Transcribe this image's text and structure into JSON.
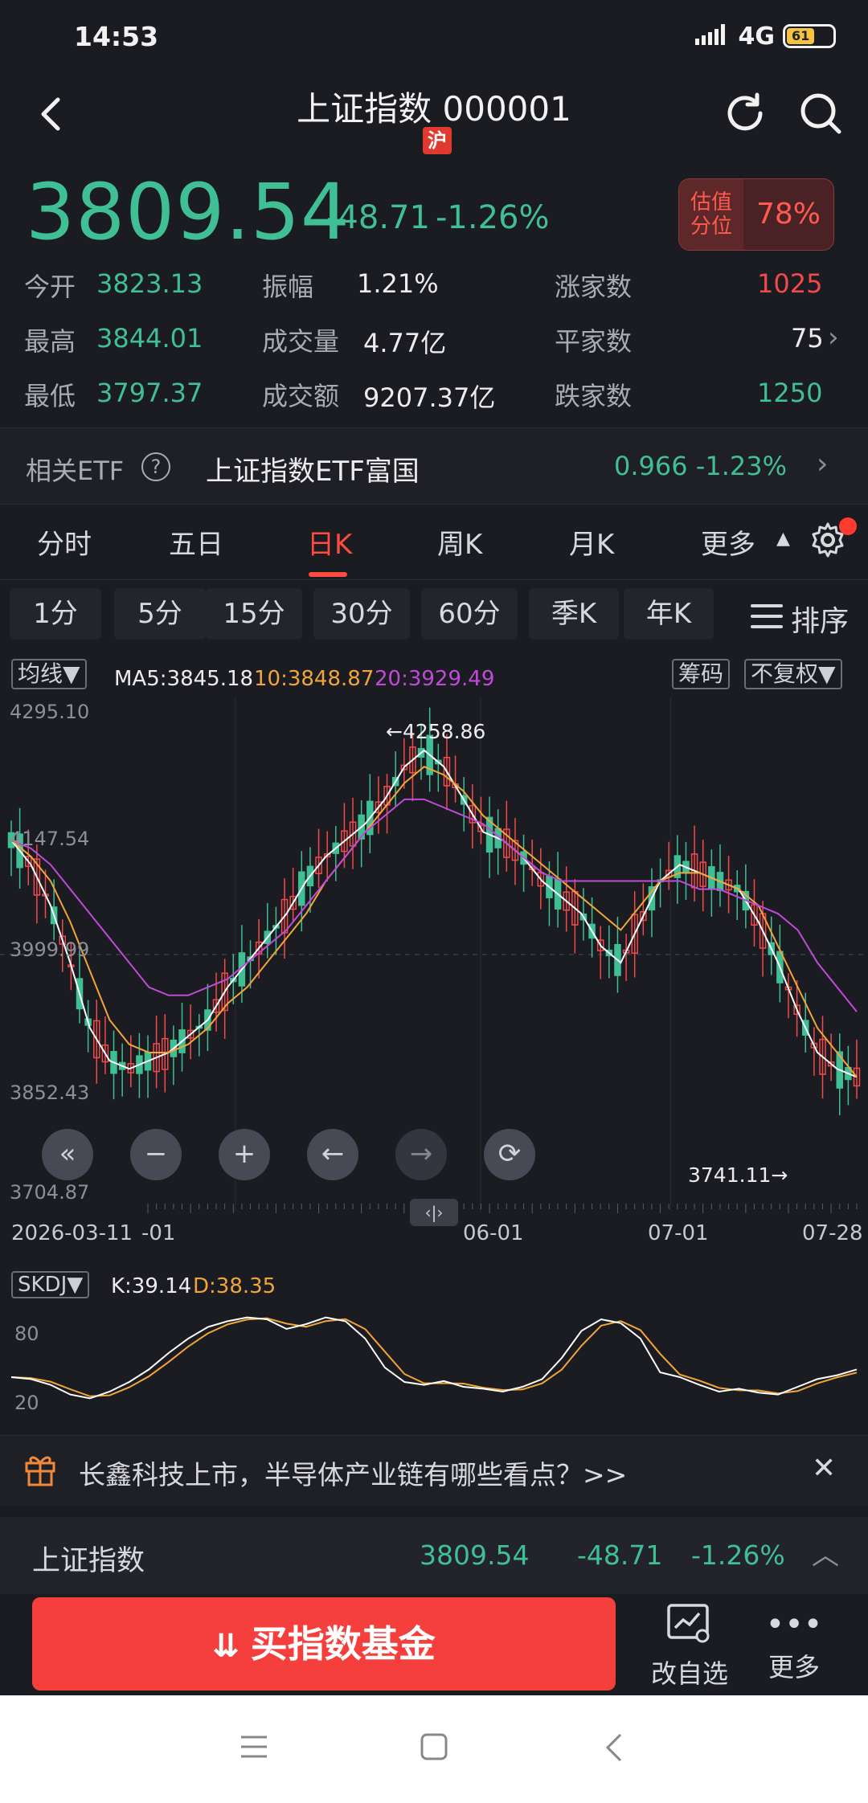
{
  "status_bar": {
    "time": "14:53",
    "network": "4G",
    "battery": "61"
  },
  "header": {
    "title": "上证指数 000001",
    "market_badge": "沪"
  },
  "quote": {
    "price": "3809.54",
    "change": "-48.71",
    "change_pct": "-1.26%",
    "valuation_label_line1": "估值",
    "valuation_label_line2": "分位",
    "valuation_value": "78%"
  },
  "stats": {
    "open_label": "今开",
    "open": "3823.13",
    "high_label": "最高",
    "high": "3844.01",
    "low_label": "最低",
    "low": "3797.37",
    "amplitude_label": "振幅",
    "amplitude": "1.21%",
    "volume_label": "成交量",
    "volume": "4.77亿",
    "turnover_label": "成交额",
    "turnover": "9207.37亿",
    "up_label": "涨家数",
    "up": "1025",
    "flat_label": "平家数",
    "flat": "75",
    "down_label": "跌家数",
    "down": "1250"
  },
  "etf": {
    "label": "相关ETF",
    "name": "上证指数ETF富国",
    "quote": "0.966 -1.23%"
  },
  "period_tabs": [
    "分时",
    "五日",
    "日K",
    "周K",
    "月K",
    "更多"
  ],
  "minute_tabs": [
    "1分",
    "5分",
    "15分",
    "30分",
    "60分",
    "季K",
    "年K"
  ],
  "sort_label": "排序",
  "chart": {
    "indicator_select": "均线▼",
    "ma5": "MA5:3845.18",
    "ma10": "10:3848.87",
    "ma20": "20:3929.49",
    "chips_btn": "筹码",
    "adjust_btn": "不复权▼",
    "y_labels": [
      "4295.10",
      "4147.54",
      "3999.99",
      "3852.43",
      "3704.87"
    ],
    "max_annot": "←4258.86",
    "min_annot": "3741.11→",
    "x_labels": [
      "2026-03-11",
      "-01",
      "06-01",
      "07-01",
      "07-28"
    ],
    "colors": {
      "up": "#f24a4a",
      "down": "#3fbf93",
      "ma5": "#ffffff",
      "ma10": "#f0a53a",
      "ma20": "#c04ad8"
    }
  },
  "chart_data": {
    "type": "line",
    "title": "",
    "y_ticks": [
      4295.1,
      4147.54,
      3999.99,
      3852.43,
      3704.87
    ],
    "x_ticks": [
      "2026-03-11",
      "-01",
      "06-01",
      "07-01",
      "07-28"
    ],
    "series": [
      {
        "name": "MA5",
        "values": [
          4140,
          4110,
          4060,
          3990,
          3910,
          3870,
          3860,
          3870,
          3880,
          3900,
          3920,
          3960,
          3990,
          4020,
          4050,
          4090,
          4120,
          4140,
          4160,
          4190,
          4230,
          4250,
          4230,
          4190,
          4150,
          4140,
          4120,
          4090,
          4070,
          4050,
          4010,
          3990,
          4040,
          4090,
          4110,
          4100,
          4090,
          4080,
          4040,
          3990,
          3930,
          3880,
          3860,
          3850
        ]
      },
      {
        "name": "10",
        "values": [
          4140,
          4120,
          4090,
          4040,
          3980,
          3920,
          3890,
          3880,
          3880,
          3890,
          3910,
          3940,
          3960,
          3990,
          4020,
          4050,
          4090,
          4120,
          4150,
          4180,
          4210,
          4230,
          4220,
          4200,
          4170,
          4150,
          4130,
          4110,
          4090,
          4070,
          4050,
          4030,
          4060,
          4090,
          4100,
          4100,
          4090,
          4080,
          4060,
          4010,
          3960,
          3910,
          3880,
          3850
        ]
      },
      {
        "name": "20",
        "values": [
          4140,
          4130,
          4110,
          4080,
          4050,
          4020,
          3990,
          3960,
          3950,
          3950,
          3960,
          3970,
          3990,
          4010,
          4030,
          4060,
          4090,
          4120,
          4150,
          4170,
          4190,
          4190,
          4180,
          4170,
          4160,
          4140,
          4120,
          4100,
          4090,
          4090,
          4090,
          4090,
          4090,
          4090,
          4090,
          4080,
          4080,
          4070,
          4060,
          4050,
          4030,
          3990,
          3960,
          3930
        ]
      }
    ],
    "skdj": {
      "label": "SKDJ▼",
      "k": "K:39.14",
      "d": "D:38.35",
      "y_labels": [
        "80",
        "20"
      ]
    }
  },
  "banner": {
    "text": "长鑫科技上市，半导体产业链有哪些看点？>>"
  },
  "bottom_quote": {
    "name": "上证指数",
    "price": "3809.54",
    "change": "-48.71",
    "change_pct": "-1.26%"
  },
  "actions": {
    "buy": "买指数基金",
    "watch": "改自选",
    "more": "更多"
  }
}
